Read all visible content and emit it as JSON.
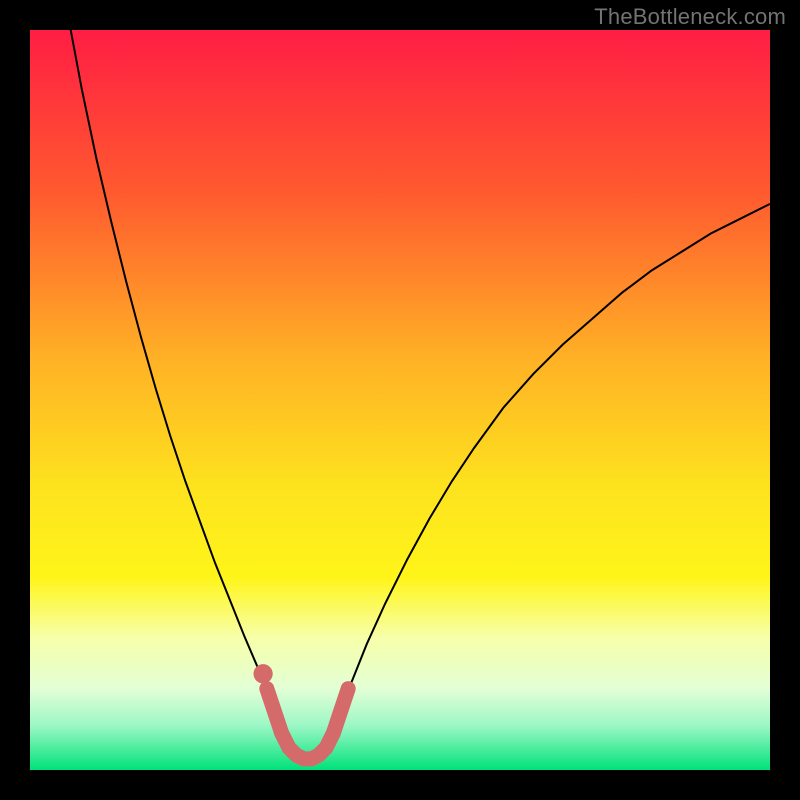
{
  "watermark": "TheBottleneck.com",
  "chart_data": {
    "type": "line",
    "title": "",
    "xlabel": "",
    "ylabel": "",
    "xlim": [
      0,
      100
    ],
    "ylim": [
      0,
      100
    ],
    "gradient_stops": [
      {
        "offset": 0.0,
        "color": "#ff1d44"
      },
      {
        "offset": 0.22,
        "color": "#ff5a2f"
      },
      {
        "offset": 0.45,
        "color": "#ffb325"
      },
      {
        "offset": 0.62,
        "color": "#fde31e"
      },
      {
        "offset": 0.74,
        "color": "#fff51a"
      },
      {
        "offset": 0.82,
        "color": "#f7ffa8"
      },
      {
        "offset": 0.89,
        "color": "#e3ffd6"
      },
      {
        "offset": 0.94,
        "color": "#9cf7c5"
      },
      {
        "offset": 1.0,
        "color": "#00e27a"
      }
    ],
    "series": [
      {
        "name": "curve-left",
        "stroke": "#000000",
        "stroke_width": 2,
        "points": [
          {
            "x": 5.5,
            "y": 100.0
          },
          {
            "x": 7.0,
            "y": 92.0
          },
          {
            "x": 9.0,
            "y": 82.5
          },
          {
            "x": 11.0,
            "y": 74.0
          },
          {
            "x": 13.0,
            "y": 66.0
          },
          {
            "x": 15.0,
            "y": 58.5
          },
          {
            "x": 17.0,
            "y": 51.5
          },
          {
            "x": 19.0,
            "y": 45.0
          },
          {
            "x": 21.0,
            "y": 39.0
          },
          {
            "x": 23.0,
            "y": 33.5
          },
          {
            "x": 25.0,
            "y": 28.0
          },
          {
            "x": 27.0,
            "y": 23.0
          },
          {
            "x": 29.0,
            "y": 18.0
          },
          {
            "x": 30.5,
            "y": 14.5
          },
          {
            "x": 32.0,
            "y": 11.0
          },
          {
            "x": 33.0,
            "y": 8.5
          }
        ]
      },
      {
        "name": "curve-right",
        "stroke": "#000000",
        "stroke_width": 2,
        "points": [
          {
            "x": 42.0,
            "y": 8.5
          },
          {
            "x": 43.5,
            "y": 12.0
          },
          {
            "x": 45.5,
            "y": 17.0
          },
          {
            "x": 48.0,
            "y": 22.5
          },
          {
            "x": 51.0,
            "y": 28.5
          },
          {
            "x": 54.0,
            "y": 34.0
          },
          {
            "x": 57.0,
            "y": 39.0
          },
          {
            "x": 60.0,
            "y": 43.5
          },
          {
            "x": 64.0,
            "y": 49.0
          },
          {
            "x": 68.0,
            "y": 53.5
          },
          {
            "x": 72.0,
            "y": 57.5
          },
          {
            "x": 76.0,
            "y": 61.0
          },
          {
            "x": 80.0,
            "y": 64.5
          },
          {
            "x": 84.0,
            "y": 67.5
          },
          {
            "x": 88.0,
            "y": 70.0
          },
          {
            "x": 92.0,
            "y": 72.5
          },
          {
            "x": 96.0,
            "y": 74.5
          },
          {
            "x": 100.0,
            "y": 76.5
          }
        ]
      },
      {
        "name": "trough-highlight",
        "stroke": "#d46a6a",
        "stroke_width": 15,
        "linecap": "round",
        "points": [
          {
            "x": 32.0,
            "y": 11.0
          },
          {
            "x": 33.0,
            "y": 8.0
          },
          {
            "x": 34.0,
            "y": 5.0
          },
          {
            "x": 35.0,
            "y": 3.0
          },
          {
            "x": 36.0,
            "y": 2.0
          },
          {
            "x": 37.0,
            "y": 1.5
          },
          {
            "x": 38.0,
            "y": 1.5
          },
          {
            "x": 39.0,
            "y": 2.0
          },
          {
            "x": 40.0,
            "y": 3.0
          },
          {
            "x": 41.0,
            "y": 5.0
          },
          {
            "x": 42.0,
            "y": 8.0
          },
          {
            "x": 43.0,
            "y": 11.0
          }
        ]
      }
    ],
    "markers": [
      {
        "name": "trough-dot",
        "x": 31.5,
        "y": 13.0,
        "r": 1.3,
        "color": "#d46a6a"
      }
    ]
  }
}
